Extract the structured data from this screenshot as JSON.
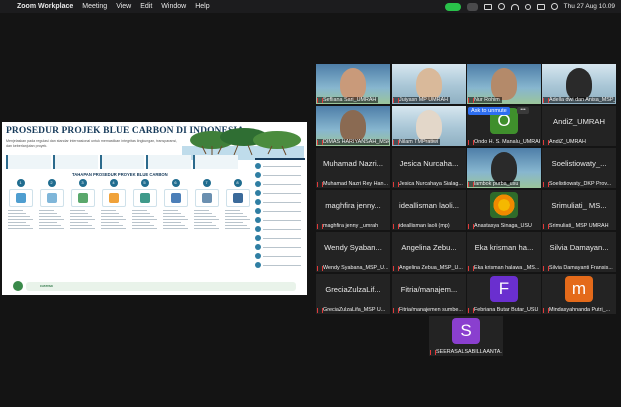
{
  "menubar": {
    "items": [
      "Zoom Workplace",
      "Meeting",
      "View",
      "Edit",
      "Window",
      "Help"
    ],
    "clock": "Thu 27 Aug  10.09"
  },
  "share": {
    "title": "PROSEDUR PROJEK BLUE CARBON DI INDONESIA",
    "subtitle": "Menjelaskan pada regulasi dan standar internasional untuk memastikan integritas lingkungan, transparansi, dan keberlanjutan proyek.",
    "steps_title": "TAHAPAN PROSEDUR PROYEK BLUE CARBON",
    "footer_label": "CATATAN",
    "colors": {
      "navy": "#163a5a",
      "teal": "#1f6c8f"
    }
  },
  "tiles": [
    {
      "caption": "Sefliana Sari_UMRAH",
      "kind": "camera"
    },
    {
      "caption": "Juiyasn MP UMRAH",
      "kind": "camera"
    },
    {
      "caption": "Nur Rohim",
      "kind": "camera"
    },
    {
      "caption": "Adella dwi dan Anisa_MSP_...",
      "kind": "camera"
    },
    {
      "caption": "DIMAS HARIYANSAH_MSP_...",
      "kind": "camera"
    },
    {
      "caption": "Nilam TMPratiwi",
      "kind": "camera"
    },
    {
      "caption": "Ondo H. S. Manalu_UMRAH",
      "kind": "avatar",
      "initial": "O",
      "color": "#3f8f2c"
    },
    {
      "caption": "AndiZ_UMRAH",
      "kind": "name",
      "name": "AndiZ_UMRAH"
    },
    {
      "caption": "Muhamad Nazri Rey Han...",
      "kind": "name",
      "name": "Muhamad Nazri..."
    },
    {
      "caption": "Jesica Nurcahaya Sialag...",
      "kind": "name",
      "name": "Jesica Nurcaha..."
    },
    {
      "caption": "lambok purba_usu",
      "kind": "camera"
    },
    {
      "caption": "Soelistiowaty_DKP Prov...",
      "kind": "name",
      "name": "Soelistiowaty_..."
    },
    {
      "caption": "maghfira jenny _umrah",
      "kind": "name",
      "name": "maghfira jenny..."
    },
    {
      "caption": "ideallisman laoli (mp)",
      "kind": "name",
      "name": "ideallisman laoli..."
    },
    {
      "caption": "Anastasya Sinaga_USU",
      "kind": "flower"
    },
    {
      "caption": "Srimuliati_ MSP UMRAH",
      "kind": "name",
      "name": "Srimuliati_ MS..."
    },
    {
      "caption": "Wendy Syabana_MSP_U...",
      "kind": "name",
      "name": "Wendy Syaban..."
    },
    {
      "caption": "Angelina  Zebua_MSP_U...",
      "kind": "name",
      "name": "Angelina  Zebu..."
    },
    {
      "caption": "Eka krisman halawa _MS...",
      "kind": "name",
      "name": "Eka krisman ha..."
    },
    {
      "caption": "Silvia Damayanti Fransis...",
      "kind": "name",
      "name": "Silvia Damayan..."
    },
    {
      "caption": "GreciaZulzaLifa_MSP U...",
      "kind": "name",
      "name": "GreciaZulzaLif..."
    },
    {
      "caption": "Fitria/manajemen sumbe...",
      "kind": "name",
      "name": "Fitria/manajem..."
    },
    {
      "caption": "Febriana Butar Butar_USU",
      "kind": "avatar",
      "initial": "F",
      "color": "#6a2fcf"
    },
    {
      "caption": "Mindasyahnanda Putri_...",
      "kind": "avatar",
      "initial": "m",
      "color": "#e46a1a"
    },
    {
      "caption": "SEERASALSABILLAANTA...",
      "kind": "avatar",
      "initial": "S",
      "color": "#8a3fcf"
    }
  ],
  "ask_to_unmute": "Ask to unmute",
  "more_btn": "•••"
}
